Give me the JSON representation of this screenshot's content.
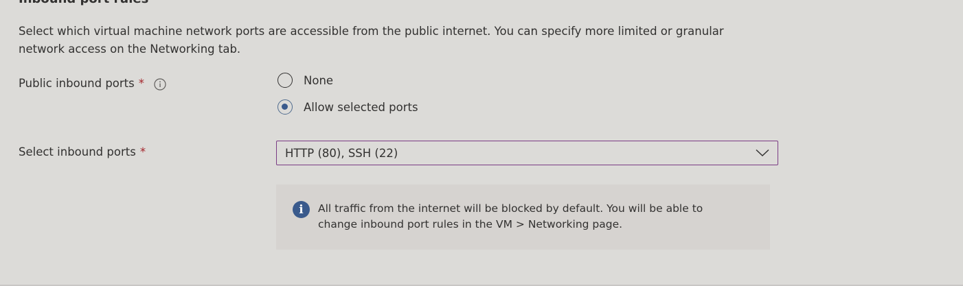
{
  "section": {
    "title": "Inbound port rules",
    "description": "Select which virtual machine network ports are accessible from the public internet. You can specify more limited or granular network access on the Networking tab."
  },
  "public_inbound": {
    "label": "Public inbound ports",
    "required_mark": "*",
    "info_icon": "info-circle-icon",
    "options": [
      {
        "label": "None",
        "checked": false
      },
      {
        "label": "Allow selected ports",
        "checked": true
      }
    ]
  },
  "select_ports": {
    "label": "Select inbound ports",
    "required_mark": "*",
    "value": "HTTP (80), SSH (22)",
    "icon": "chevron-down-icon"
  },
  "info_message": {
    "icon": "info-icon",
    "text": "All traffic from the internet will be blocked by default. You will be able to change inbound port rules in the VM > Networking page."
  },
  "colors": {
    "background": "#dcdbd8",
    "accent": "#3a5a8c",
    "required": "#a4262c",
    "dropdown_border": "#7a3b84"
  }
}
